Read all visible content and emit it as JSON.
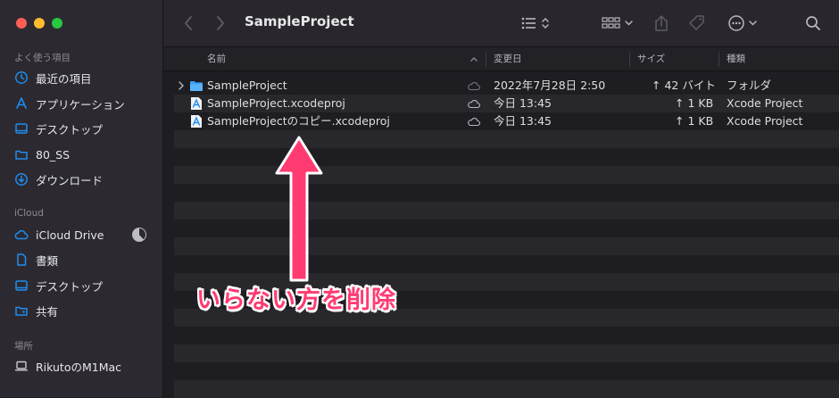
{
  "window": {
    "title": "SampleProject"
  },
  "sidebar": {
    "favorites_header": "よく使う項目",
    "favorites": [
      {
        "label": "最近の項目",
        "icon": "clock-icon"
      },
      {
        "label": "アプリケーション",
        "icon": "applications-icon"
      },
      {
        "label": "デスクトップ",
        "icon": "desktop-icon"
      },
      {
        "label": "80_SS",
        "icon": "folder-icon"
      },
      {
        "label": "ダウンロード",
        "icon": "download-icon"
      }
    ],
    "icloud_header": "iCloud",
    "icloud": [
      {
        "label": "iCloud Drive",
        "icon": "cloud-icon"
      },
      {
        "label": "書類",
        "icon": "document-icon"
      },
      {
        "label": "デスクトップ",
        "icon": "desktop-icon"
      },
      {
        "label": "共有",
        "icon": "shared-folder-icon"
      }
    ],
    "locations_header": "場所",
    "locations": [
      {
        "label": "RikutoのM1Mac",
        "icon": "laptop-icon"
      }
    ]
  },
  "columns": {
    "name": "名前",
    "modified": "変更日",
    "size": "サイズ",
    "kind": "種類"
  },
  "files": [
    {
      "name": "SampleProject",
      "modified": "2022年7月28日 2:50",
      "size": "↑ 42 バイト",
      "kind": "フォルダ",
      "type": "folder"
    },
    {
      "name": "SampleProject.xcodeproj",
      "modified": "今日 13:45",
      "size": "↑ 1 KB",
      "kind": "Xcode Project",
      "type": "xcodeproj"
    },
    {
      "name": "SampleProjectのコピー.xcodeproj",
      "modified": "今日 13:45",
      "size": "↑ 1 KB",
      "kind": "Xcode Project",
      "type": "xcodeproj"
    }
  ],
  "annotation": {
    "text": "いらない方を削除"
  },
  "colors": {
    "accent": "#1f8cf0",
    "annotation": "#ff3b72"
  }
}
